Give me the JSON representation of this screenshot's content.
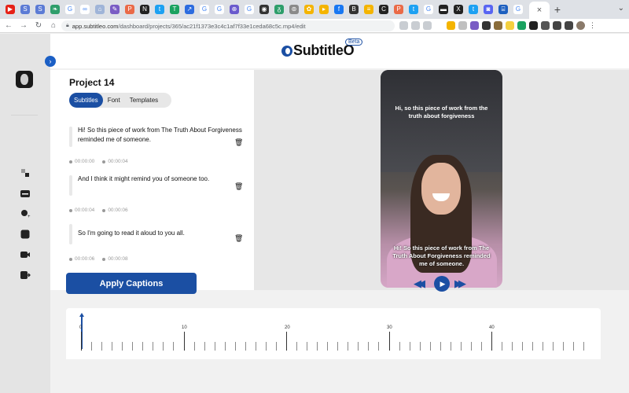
{
  "browser": {
    "active_tab_close": "×",
    "new_tab": "+",
    "url_host": "app.subtitleo.com",
    "url_path": "/dashboard/projects/365/ac21f1373e3c4c1af7f33e1ceda68c5c.mp4/edit",
    "tab_favicons": [
      {
        "color": "#e62117",
        "glyph": "▶"
      },
      {
        "color": "#5b7bd5",
        "glyph": "S"
      },
      {
        "color": "#5b7bd5",
        "glyph": "S"
      },
      {
        "color": "#2e9e6b",
        "glyph": "❧"
      },
      {
        "color": "#ffffff",
        "glyph": "G"
      },
      {
        "color": "#ffffff",
        "glyph": "∞"
      },
      {
        "color": "#9fb4d8",
        "glyph": "⌂"
      },
      {
        "color": "#7a5cc4",
        "glyph": "✎"
      },
      {
        "color": "#ea6a47",
        "glyph": "P"
      },
      {
        "color": "#222222",
        "glyph": "N"
      },
      {
        "color": "#1da1f2",
        "glyph": "t"
      },
      {
        "color": "#1aa260",
        "glyph": "T"
      },
      {
        "color": "#2d6cdf",
        "glyph": "↗"
      },
      {
        "color": "#ffffff",
        "glyph": "G"
      },
      {
        "color": "#ffffff",
        "glyph": "G"
      },
      {
        "color": "#6a5acd",
        "glyph": "⊕"
      },
      {
        "color": "#ffffff",
        "glyph": "G"
      },
      {
        "color": "#333333",
        "glyph": "◉"
      },
      {
        "color": "#2e9e6b",
        "glyph": "ᵹ"
      },
      {
        "color": "#8a8a8a",
        "glyph": "⊚"
      },
      {
        "color": "#f4b400",
        "glyph": "✿"
      },
      {
        "color": "#f4b400",
        "glyph": "▸"
      },
      {
        "color": "#1877f2",
        "glyph": "f"
      },
      {
        "color": "#333333",
        "glyph": "B"
      },
      {
        "color": "#f4b400",
        "glyph": "≡"
      },
      {
        "color": "#222222",
        "glyph": "C"
      },
      {
        "color": "#ea6a47",
        "glyph": "P"
      },
      {
        "color": "#1da1f2",
        "glyph": "t"
      },
      {
        "color": "#ffffff",
        "glyph": "G"
      },
      {
        "color": "#222222",
        "glyph": "▬"
      },
      {
        "color": "#222222",
        "glyph": "X"
      },
      {
        "color": "#1da1f2",
        "glyph": "t"
      },
      {
        "color": "#5865f2",
        "glyph": "◙"
      },
      {
        "color": "#1d5fbf",
        "glyph": "⌸"
      },
      {
        "color": "#ffffff",
        "glyph": "G"
      }
    ]
  },
  "app": {
    "brand": "SubtitleO",
    "beta": "Beta",
    "project_title": "Project 14",
    "tabs": [
      "Subtitles",
      "Font",
      "Templates"
    ],
    "captions": [
      {
        "text": "Hi! So this piece of work from The Truth About Forgiveness reminded me of someone.",
        "start": "00:00:00",
        "end": "00:00:04"
      },
      {
        "text": "And I think it might remind you of someone too.",
        "start": "00:00:04",
        "end": "00:00:06"
      },
      {
        "text": "So I'm going to read it aloud to you all.",
        "start": "00:00:06",
        "end": "00:00:08"
      }
    ],
    "video_caption_top": "Hi, so this piece of work from the truth about forgiveness",
    "video_caption_bottom": "Hi! So this piece of work from The Truth About Forgiveness reminded me of someone.",
    "apply_label": "Apply Captions",
    "player": {
      "rewind": "◀◀",
      "play": "▶",
      "forward": "▶▶"
    },
    "timeline_labels": [
      "0",
      "10",
      "20",
      "30",
      "40"
    ],
    "accent": "#1b4fa3"
  }
}
